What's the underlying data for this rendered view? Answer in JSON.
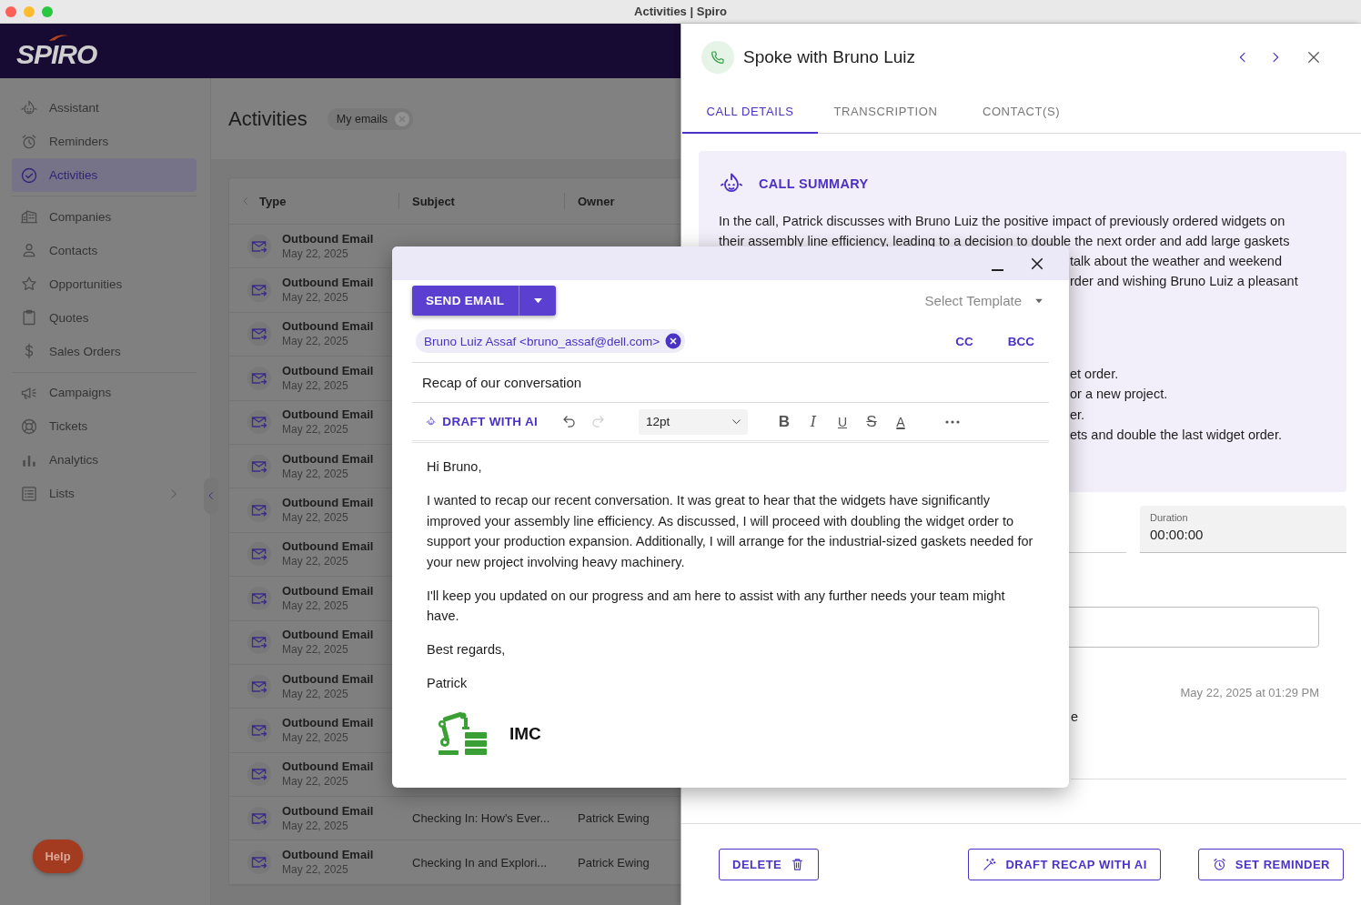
{
  "window": {
    "title": "Activities | Spiro"
  },
  "header": {
    "logo": "SPIRO"
  },
  "sidebar": {
    "sections": [
      {
        "items": [
          {
            "label": "Assistant",
            "selected": false,
            "has_submenu": false
          },
          {
            "label": "Reminders",
            "selected": false,
            "has_submenu": false
          },
          {
            "label": "Activities",
            "selected": true,
            "has_submenu": false
          }
        ]
      },
      {
        "items": [
          {
            "label": "Companies",
            "selected": false,
            "has_submenu": false
          },
          {
            "label": "Contacts",
            "selected": false,
            "has_submenu": false
          },
          {
            "label": "Opportunities",
            "selected": false,
            "has_submenu": false
          },
          {
            "label": "Quotes",
            "selected": false,
            "has_submenu": false
          },
          {
            "label": "Sales Orders",
            "selected": false,
            "has_submenu": false
          }
        ]
      },
      {
        "items": [
          {
            "label": "Campaigns",
            "selected": false,
            "has_submenu": false
          },
          {
            "label": "Tickets",
            "selected": false,
            "has_submenu": false
          },
          {
            "label": "Analytics",
            "selected": false,
            "has_submenu": false
          },
          {
            "label": "Lists",
            "selected": false,
            "has_submenu": true
          }
        ]
      }
    ],
    "help_button": "Help"
  },
  "page": {
    "title": "Activities",
    "filter_chip": "My emails"
  },
  "table": {
    "columns": [
      "Type",
      "Subject",
      "Owner"
    ],
    "rows": [
      {
        "type": "Outbound Email",
        "date": "May 22, 2025"
      },
      {
        "type": "Outbound Email",
        "date": "May 22, 2025"
      },
      {
        "type": "Outbound Email",
        "date": "May 22, 2025"
      },
      {
        "type": "Outbound Email",
        "date": "May 22, 2025"
      },
      {
        "type": "Outbound Email",
        "date": "May 22, 2025"
      },
      {
        "type": "Outbound Email",
        "date": "May 22, 2025"
      },
      {
        "type": "Outbound Email",
        "date": "May 22, 2025"
      },
      {
        "type": "Outbound Email",
        "date": "May 22, 2025"
      },
      {
        "type": "Outbound Email",
        "date": "May 22, 2025"
      },
      {
        "type": "Outbound Email",
        "date": "May 22, 2025"
      },
      {
        "type": "Outbound Email",
        "date": "May 22, 2025"
      },
      {
        "type": "Outbound Email",
        "date": "May 22, 2025"
      },
      {
        "type": "Outbound Email",
        "date": "May 22, 2025"
      },
      {
        "type": "Outbound Email",
        "date": "May 22, 2025",
        "subject": "Checking In: How's Ever...",
        "owner": "Patrick Ewing"
      },
      {
        "type": "Outbound Email",
        "date": "May 22, 2025",
        "subject": "Checking In and Explori...",
        "owner": "Patrick Ewing"
      }
    ]
  },
  "detail": {
    "title": "Spoke with Bruno Luiz",
    "tabs": [
      {
        "label": "CALL DETAILS",
        "selected": true
      },
      {
        "label": "TRANSCRIPTION",
        "selected": false
      },
      {
        "label": "CONTACT(S)",
        "selected": false
      }
    ],
    "summary": {
      "title": "CALL SUMMARY",
      "paragraph": [
        {
          "text": "In the call, Patrick discusses with Bruno Luiz the positive impact of previously ordered widgets on",
          "kind": "full"
        },
        {
          "text": "their assembly line efficiency, leading to a decision to double the next order and add large gaskets",
          "kind": "full"
        },
        {
          "text": "talk about the weather and weekend",
          "kind": "clipped"
        },
        {
          "text": "rder and wishing Bruno Luiz a pleasant",
          "kind": "clipped"
        }
      ],
      "bullets": [
        {
          "text": "et order.",
          "kind": "clipped"
        },
        {
          "text": "or a new project.",
          "kind": "clipped"
        },
        {
          "text": "er.",
          "kind": "clipped"
        },
        {
          "text": "ets and double the last widget order.",
          "kind": "clipped"
        }
      ]
    },
    "duration": {
      "label": "Duration",
      "value": "00:00:00"
    },
    "timestamp": "May 22, 2025 at 01:29 PM",
    "note_fragment": "e",
    "buttons": [
      {
        "label": "DELETE",
        "kind": "delete"
      },
      {
        "label": "DRAFT RECAP WITH AI",
        "kind": "ai"
      },
      {
        "label": "SET REMINDER",
        "kind": "reminder"
      }
    ]
  },
  "compose": {
    "send_label": "SEND EMAIL",
    "template_placeholder": "Select Template",
    "recipients": [
      "Bruno Luiz Assaf <bruno_assaf@dell.com>"
    ],
    "cc": "CC",
    "bcc": "BCC",
    "subject": "Recap of our conversation",
    "ai_label": "DRAFT WITH AI",
    "history": [
      {
        "kind": "undo",
        "disabled": false
      },
      {
        "kind": "redo",
        "disabled": true
      }
    ],
    "font_size": "12pt",
    "format_buttons": [
      "B",
      "I",
      "U",
      "S",
      "A"
    ],
    "body": [
      "Hi Bruno,",
      "I wanted to recap our recent conversation. It was great to hear that the widgets have significantly improved your assembly line efficiency. As discussed, I will proceed with doubling the widget order to support your production expansion. Additionally, I will arrange for the industrial-sized gaskets needed for your new project involving heavy machinery.",
      "I'll keep you updated on our progress and am here to assist with any further needs your team might have.",
      "Best regards,",
      "Patrick"
    ],
    "signature": {
      "company": "IMC"
    }
  }
}
